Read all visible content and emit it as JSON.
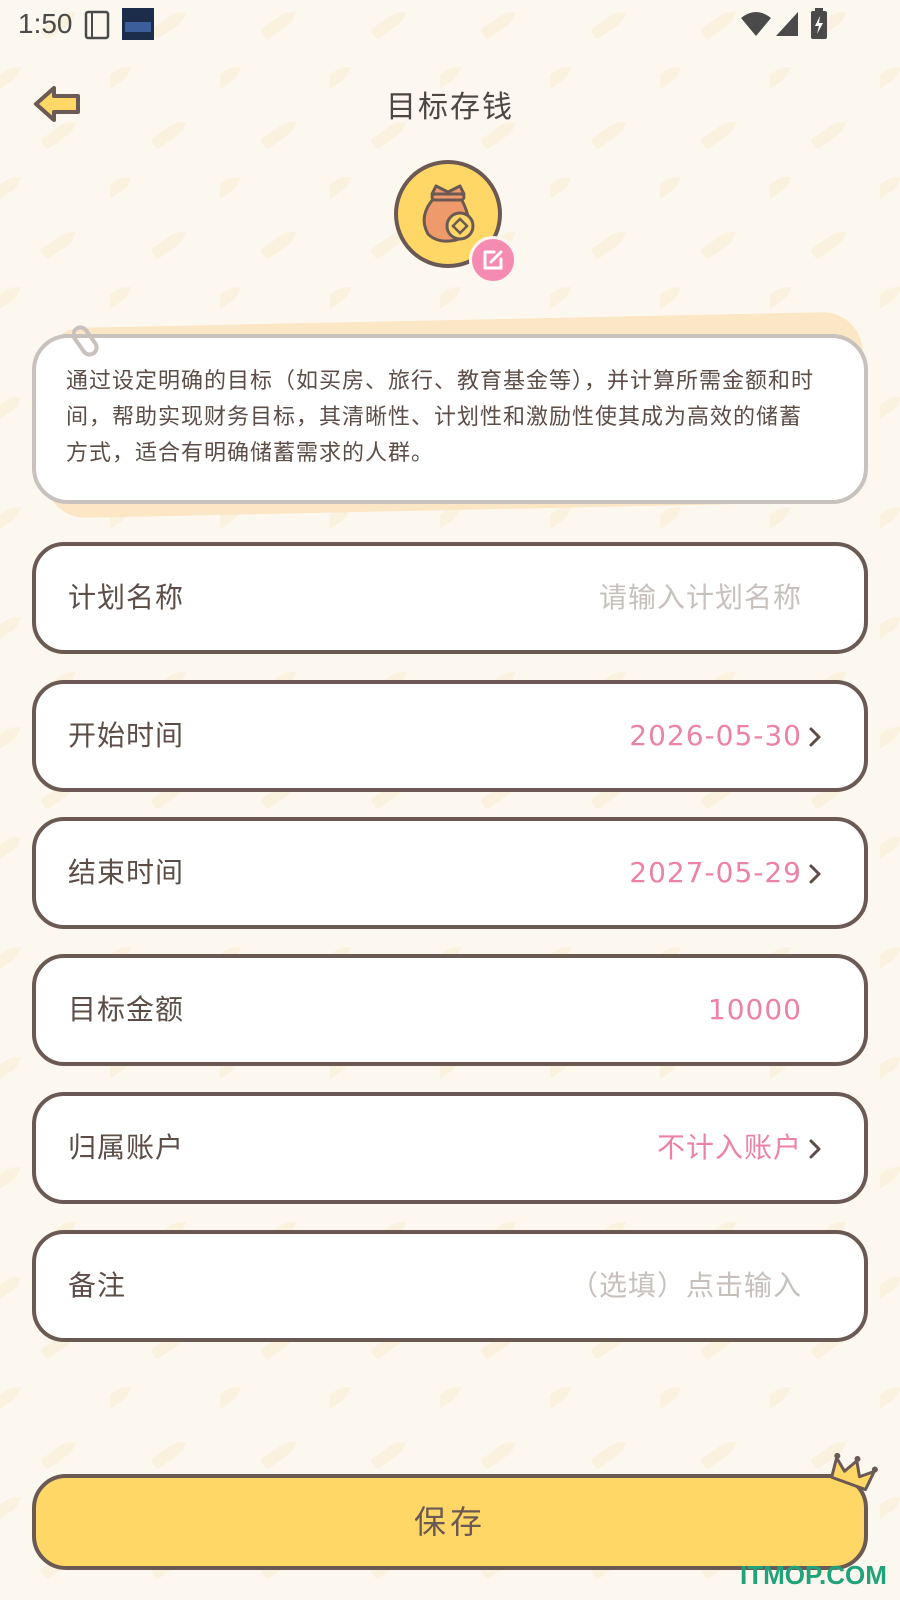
{
  "status_bar": {
    "time": "1:50"
  },
  "header": {
    "title": "目标存钱"
  },
  "intro": {
    "text": "通过设定明确的目标（如买房、旅行、教育基金等），并计算所需金额和时间，帮助实现财务目标，其清晰性、计划性和激励性使其成为高效的储蓄方式，适合有明确储蓄需求的人群。"
  },
  "form": {
    "plan_name": {
      "label": "计划名称",
      "placeholder": "请输入计划名称",
      "value": ""
    },
    "start_time": {
      "label": "开始时间",
      "value": "2026-05-30"
    },
    "end_time": {
      "label": "结束时间",
      "value": "2027-05-29"
    },
    "target_amount": {
      "label": "目标金额",
      "value": "10000"
    },
    "account": {
      "label": "归属账户",
      "value": "不计入账户"
    },
    "note": {
      "label": "备注",
      "placeholder": "（选填）点击输入",
      "value": ""
    }
  },
  "save_button": {
    "label": "保存"
  },
  "watermark": "ITMOP.COM",
  "colors": {
    "accent_yellow": "#ffd766",
    "accent_pink": "#ec82a6",
    "border_brown": "#6b5a53",
    "background": "#fdf8ef",
    "placeholder_gray": "#c7c0bd"
  },
  "icons": {
    "back": "back-arrow-icon",
    "avatar": "money-bag-icon",
    "edit": "edit-icon",
    "chevron": "chevron-right-icon",
    "clip": "paperclip-icon",
    "crown": "crown-icon"
  }
}
